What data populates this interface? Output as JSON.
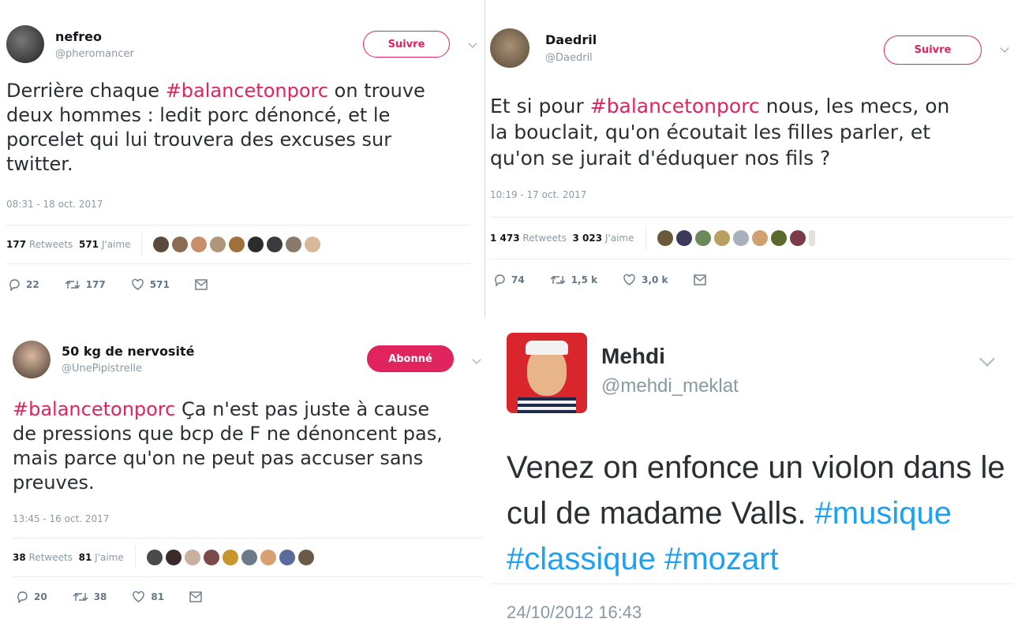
{
  "tweets": [
    {
      "name": "nefreo",
      "handle": "@pheromancer",
      "follow_label": "Suivre",
      "text_prefix": "Derrière chaque ",
      "hashtag": "#balancetonporc",
      "text_lines": [
        " on trouve",
        "deux hommes : ledit porc dénoncé, et le",
        "porcelet qui lui trouvera des excuses sur",
        "twitter."
      ],
      "timestamp": "08:31 - 18 oct. 2017",
      "retweets_count": "177",
      "retweets_label": "Retweets",
      "likes_count": "571",
      "likes_label": "J'aime",
      "replies": "22",
      "retweet_action": "177",
      "like_action": "571"
    },
    {
      "name": "Daedril",
      "handle": "@Daedril",
      "follow_label": "Suivre",
      "text_prefix": "Et si pour ",
      "hashtag": "#balancetonporc",
      "text_lines": [
        " nous, les mecs, on",
        "la bouclait, qu'on écoutait les filles parler, et",
        "qu'on se jurait d'éduquer nos fils ?"
      ],
      "timestamp": "10:19 - 17 oct. 2017",
      "retweets_count": "1 473",
      "retweets_label": "Retweets",
      "likes_count": "3 023",
      "likes_label": "J'aime",
      "replies": "74",
      "retweet_action": "1,5 k",
      "like_action": "3,0 k"
    },
    {
      "name": "50 kg de nervosité",
      "handle": "@UnePipistrelle",
      "follow_label": "Abonné",
      "text_prefix": "",
      "hashtag": "#balancetonporc",
      "text_lines": [
        " Ça n'est pas juste à cause",
        "de pressions que bcp de F ne dénoncent pas,",
        "mais parce qu'on ne peut pas accuser sans",
        "preuves."
      ],
      "timestamp": "13:45 - 16 oct. 2017",
      "retweets_count": "38",
      "retweets_label": "Retweets",
      "likes_count": "81",
      "likes_label": "J'aime",
      "replies": "20",
      "retweet_action": "38",
      "like_action": "81"
    }
  ],
  "mehdi": {
    "name": "Mehdi",
    "handle": "@mehdi_meklat",
    "line1": "Venez on enfonce un violon dans le",
    "line2_text": "cul de madame Valls. ",
    "line2_tag": "#musique",
    "line3": "#classique #mozart",
    "timestamp": "24/10/2012 16:43"
  },
  "colors": {
    "accent": "#e0245e",
    "link_blue": "#1da1f2",
    "muted": "#8b9aa6"
  },
  "icons": [
    "reply-icon",
    "retweet-icon",
    "heart-icon",
    "message-icon",
    "chevron-down-icon"
  ]
}
